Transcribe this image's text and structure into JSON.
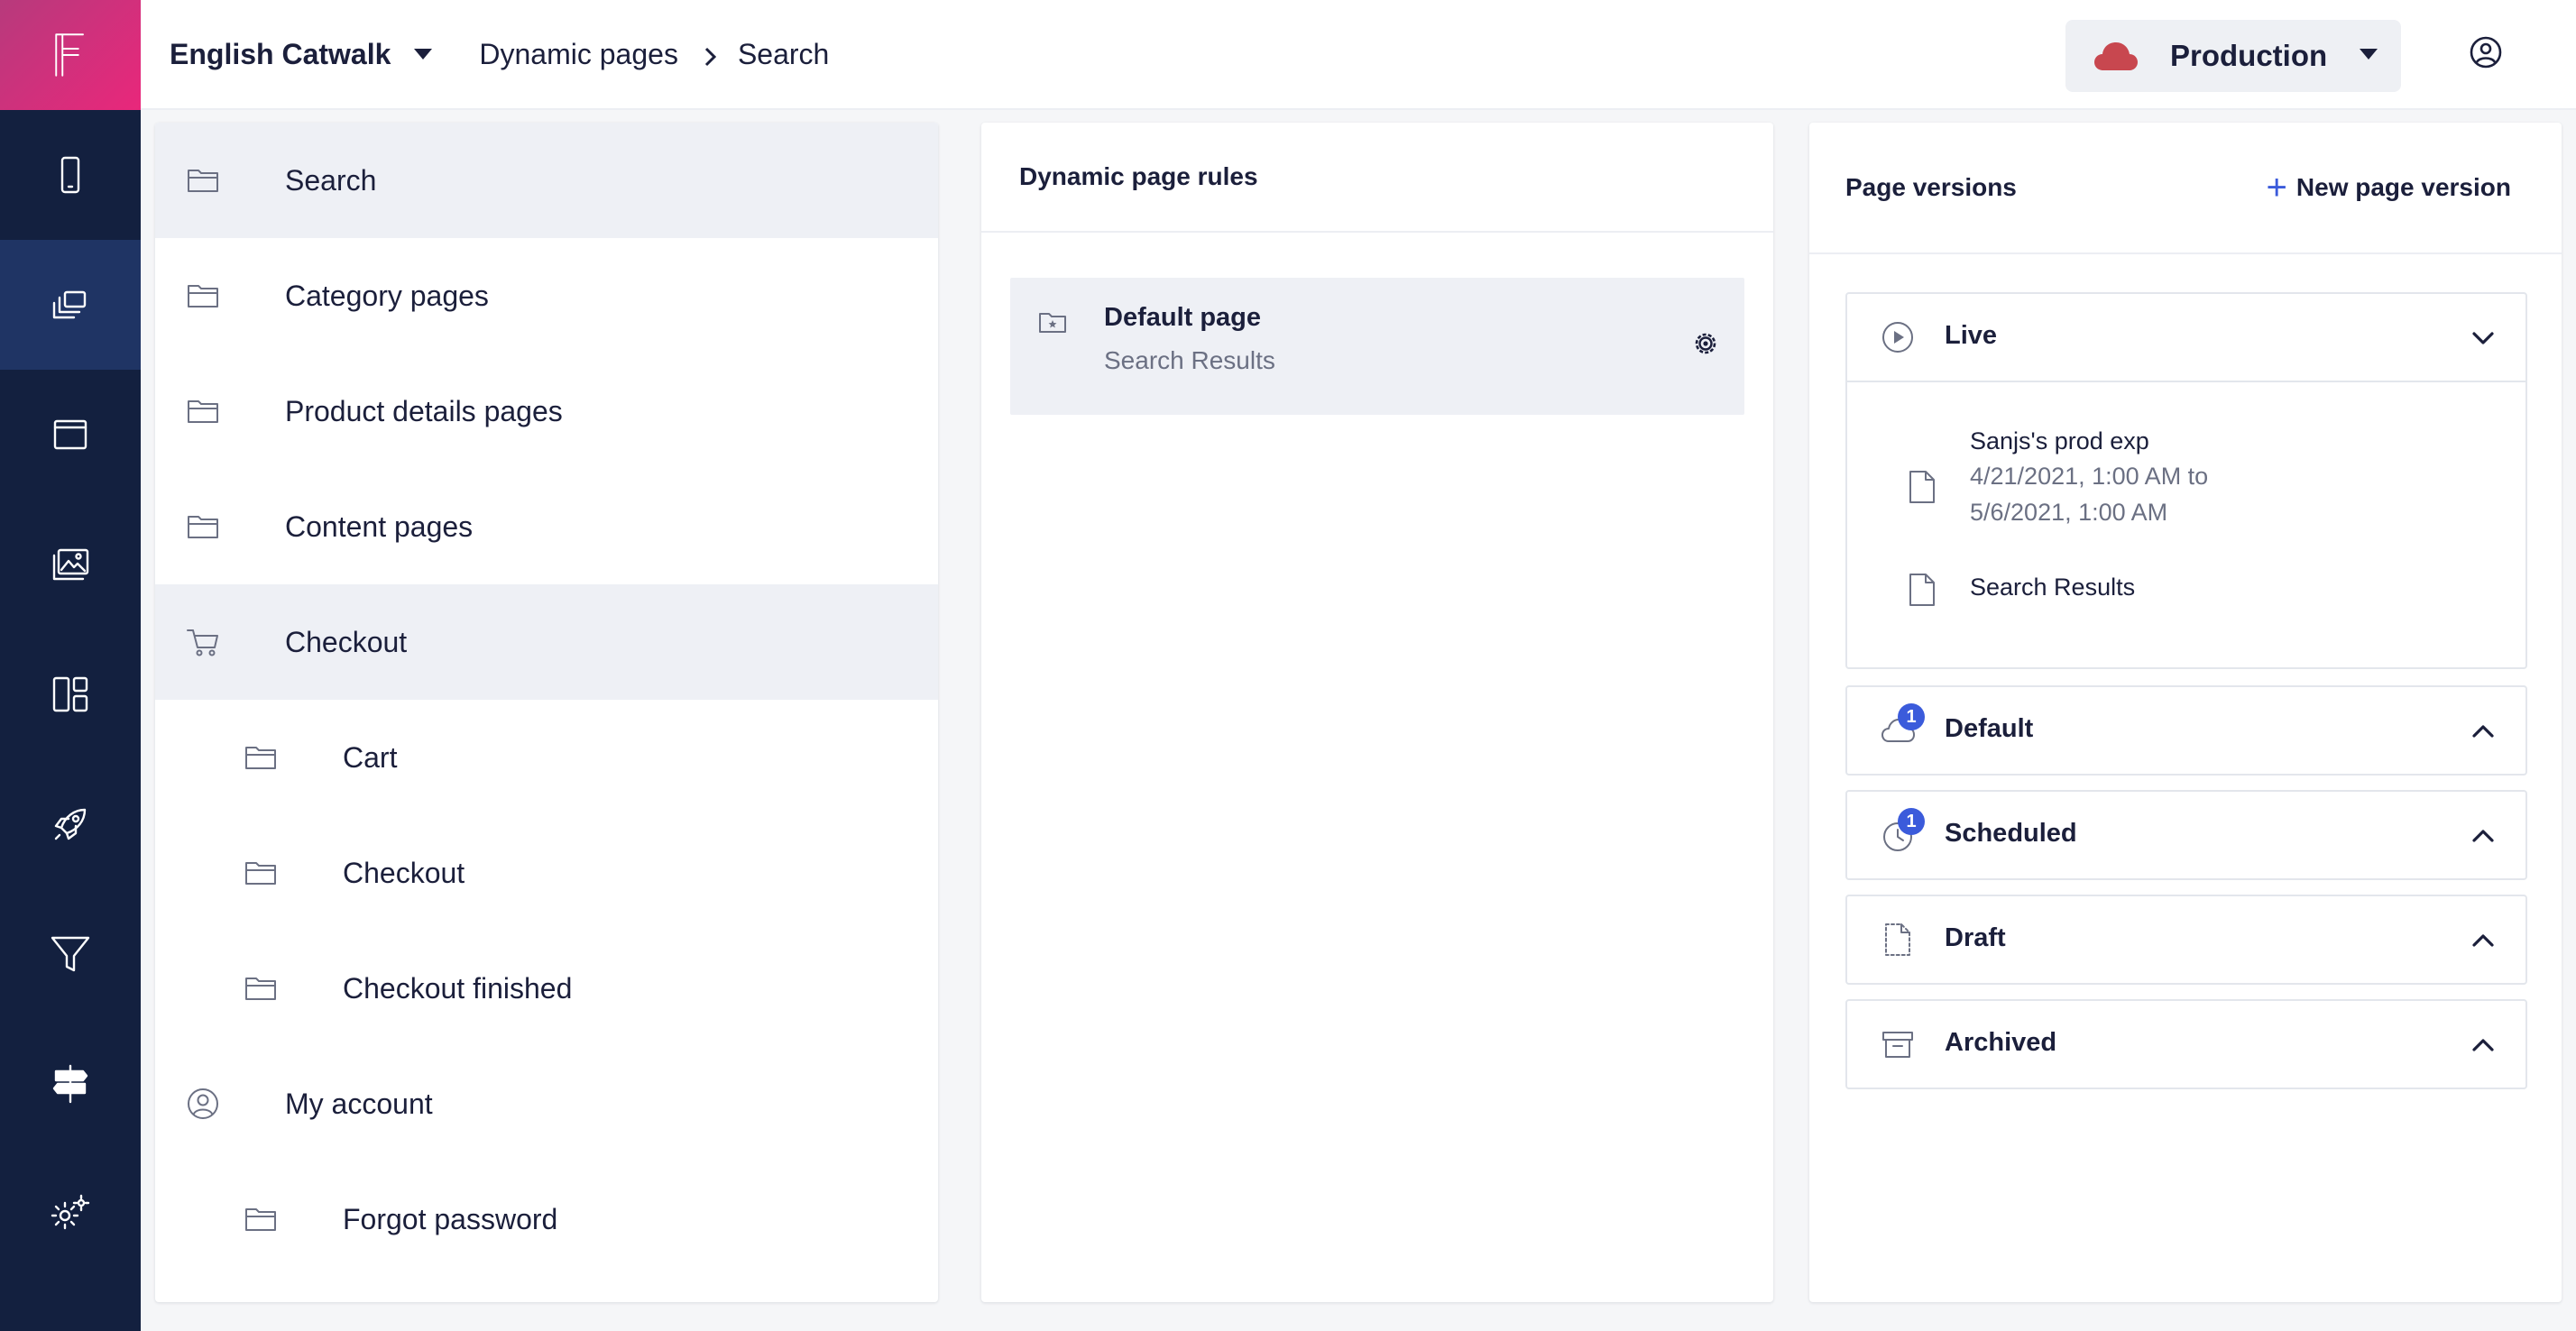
{
  "header": {
    "workspace": "English Catwalk",
    "breadcrumb": [
      "Dynamic pages",
      "Search"
    ],
    "environment": "Production",
    "environment_color": "#c8474f"
  },
  "rail": {
    "items": [
      "mobile-icon",
      "pages-icon",
      "window-icon",
      "media-icon",
      "layout-icon",
      "rocket-icon",
      "filter-icon",
      "signpost-icon",
      "settings-icon"
    ],
    "active_index": 1
  },
  "tree": {
    "items": [
      {
        "label": "Search",
        "icon": "folder-icon",
        "level": 0,
        "selected": true
      },
      {
        "label": "Category pages",
        "icon": "folder-icon",
        "level": 0
      },
      {
        "label": "Product details pages",
        "icon": "folder-icon",
        "level": 0
      },
      {
        "label": "Content pages",
        "icon": "folder-icon",
        "level": 0
      },
      {
        "label": "Checkout",
        "icon": "cart-icon",
        "level": 0,
        "selected": true
      },
      {
        "label": "Cart",
        "icon": "folder-icon",
        "level": 1
      },
      {
        "label": "Checkout",
        "icon": "folder-icon",
        "level": 1
      },
      {
        "label": "Checkout finished",
        "icon": "folder-icon",
        "level": 1
      },
      {
        "label": "My account",
        "icon": "user-circle-icon",
        "level": 0
      },
      {
        "label": "Forgot password",
        "icon": "folder-icon",
        "level": 1
      }
    ]
  },
  "rules": {
    "title": "Dynamic page rules",
    "card": {
      "title": "Default page",
      "subtitle": "Search Results"
    }
  },
  "versions": {
    "title": "Page versions",
    "new_label": "New page version",
    "live": {
      "label": "Live",
      "entries": [
        {
          "name": "Sanjs's prod exp",
          "date": "4/21/2021, 1:00 AM to 5/6/2021, 1:00 AM"
        },
        {
          "name": "Search Results"
        }
      ]
    },
    "default": {
      "label": "Default",
      "badge": "1"
    },
    "scheduled": {
      "label": "Scheduled",
      "badge": "1"
    },
    "draft": {
      "label": "Draft"
    },
    "archived": {
      "label": "Archived"
    }
  }
}
